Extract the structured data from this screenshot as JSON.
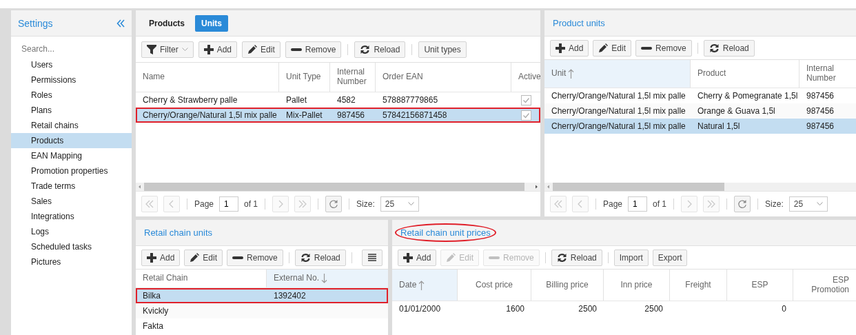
{
  "sidebar": {
    "title": "Settings",
    "search": {
      "placeholder": "Search..."
    },
    "items": [
      {
        "label": "Users",
        "selected": false
      },
      {
        "label": "Permissions",
        "selected": false
      },
      {
        "label": "Roles",
        "selected": false
      },
      {
        "label": "Plans",
        "selected": false
      },
      {
        "label": "Retail chains",
        "selected": false
      },
      {
        "label": "Products",
        "selected": true
      },
      {
        "label": "EAN Mapping",
        "selected": false
      },
      {
        "label": "Promotion properties",
        "selected": false
      },
      {
        "label": "Trade terms",
        "selected": false
      },
      {
        "label": "Sales",
        "selected": false
      },
      {
        "label": "Integrations",
        "selected": false
      },
      {
        "label": "Logs",
        "selected": false
      },
      {
        "label": "Scheduled tasks",
        "selected": false
      },
      {
        "label": "Pictures",
        "selected": false
      }
    ]
  },
  "units_panel": {
    "tabs": [
      {
        "label": "Products",
        "selected": false
      },
      {
        "label": "Units",
        "selected": true
      }
    ],
    "toolbar": [
      {
        "kind": "filter",
        "label": "Filter",
        "disabled": false,
        "separator_before": false
      },
      {
        "kind": "add",
        "label": "Add",
        "disabled": false,
        "separator_before": false
      },
      {
        "kind": "edit",
        "label": "Edit",
        "disabled": false,
        "separator_before": false
      },
      {
        "kind": "remove",
        "label": "Remove",
        "disabled": false,
        "separator_before": false
      },
      {
        "kind": "reload",
        "label": "Reload",
        "disabled": false,
        "separator_before": true
      },
      {
        "kind": "plain",
        "label": "Unit types",
        "disabled": false,
        "separator_before": true
      }
    ],
    "table": {
      "columns": [
        {
          "label": "Name"
        },
        {
          "label": "Unit Type"
        },
        {
          "label": "Internal Number"
        },
        {
          "label": "Order EAN"
        },
        {
          "label": "Active"
        }
      ],
      "rows": [
        {
          "cells": [
            "Cherry & Strawberry palle",
            "Pallet",
            "4582",
            "578887779865"
          ],
          "active": true,
          "selected": false,
          "outlined": false
        },
        {
          "cells": [
            "Cherry/Orange/Natural 1,5l mix palle",
            "Mix-Pallet",
            "987456",
            "57842156871458"
          ],
          "active": true,
          "selected": true,
          "outlined": true
        }
      ]
    },
    "pager": {
      "page_label": "Page",
      "page": "1",
      "of": "of 1",
      "size_label": "Size:",
      "size": "25"
    }
  },
  "product_units_panel": {
    "title": "Product units",
    "toolbar": [
      {
        "kind": "add",
        "label": "Add",
        "disabled": false,
        "separator_before": false
      },
      {
        "kind": "edit",
        "label": "Edit",
        "disabled": false,
        "separator_before": false
      },
      {
        "kind": "remove",
        "label": "Remove",
        "disabled": false,
        "separator_before": false
      },
      {
        "kind": "reload",
        "label": "Reload",
        "disabled": false,
        "separator_before": true
      }
    ],
    "table": {
      "columns": [
        {
          "label": "Unit",
          "sorted_ascending": true
        },
        {
          "label": "Product"
        },
        {
          "label": "Internal Number"
        }
      ],
      "rows": [
        {
          "cells": [
            "Cherry/Orange/Natural 1,5l mix palle",
            "Cherry & Pomegranate 1,5l",
            "987456"
          ],
          "selected": false,
          "outlined": false
        },
        {
          "cells": [
            "Cherry/Orange/Natural 1,5l mix palle",
            "Orange & Guava 1,5l",
            "987456"
          ],
          "selected": false,
          "outlined": false
        },
        {
          "cells": [
            "Cherry/Orange/Natural 1,5l mix palle",
            "Natural 1,5l",
            "987456"
          ],
          "selected": true,
          "outlined": false
        }
      ]
    },
    "pager": {
      "page_label": "Page",
      "page": "1",
      "of": "of 1",
      "size_label": "Size:",
      "size": "25"
    }
  },
  "retail_chain_units_panel": {
    "title": "Retail chain units",
    "toolbar": [
      {
        "kind": "add",
        "label": "Add",
        "disabled": false,
        "separator_before": false
      },
      {
        "kind": "edit",
        "label": "Edit",
        "disabled": false,
        "separator_before": false
      },
      {
        "kind": "remove",
        "label": "Remove",
        "disabled": false,
        "separator_before": false
      },
      {
        "kind": "reload",
        "label": "Reload",
        "disabled": false,
        "separator_before": true
      },
      {
        "kind": "menu",
        "disabled": false,
        "separator_before": true
      }
    ],
    "table": {
      "columns": [
        {
          "label": "Retail Chain"
        },
        {
          "label": "External No.",
          "sorted_descending": true
        }
      ],
      "rows": [
        {
          "cells": [
            "Bilka",
            "1392402"
          ],
          "selected": true,
          "outlined": true
        },
        {
          "cells": [
            "Kvickly"
          ],
          "selected": false,
          "outlined": false
        },
        {
          "cells": [
            "Fakta"
          ],
          "selected": false,
          "outlined": false
        }
      ]
    }
  },
  "prices_panel": {
    "title": "Retail chain unit prices",
    "circled": true,
    "toolbar": [
      {
        "kind": "add",
        "label": "Add",
        "disabled": false,
        "separator_before": false
      },
      {
        "kind": "edit",
        "label": "Edit",
        "disabled": true,
        "separator_before": false
      },
      {
        "kind": "remove",
        "label": "Remove",
        "disabled": true,
        "separator_before": false
      },
      {
        "kind": "reload",
        "label": "Reload",
        "disabled": false,
        "separator_before": true
      },
      {
        "kind": "plain",
        "label": "Import",
        "disabled": false,
        "separator_before": true
      },
      {
        "kind": "plain",
        "label": "Export",
        "disabled": false,
        "separator_before": false
      }
    ],
    "table": {
      "columns": [
        {
          "label": "Date",
          "sorted_ascending": true
        },
        {
          "label": "Cost price"
        },
        {
          "label": "Billing price"
        },
        {
          "label": "Inn price"
        },
        {
          "label": "Freight"
        },
        {
          "label": "ESP"
        },
        {
          "label": "ESP Promotion"
        }
      ],
      "rows": [
        {
          "cells": [
            "01/01/2000",
            "1600",
            "2500",
            "2500",
            "",
            "0",
            ""
          ],
          "selected": false,
          "outlined": false
        }
      ]
    }
  }
}
